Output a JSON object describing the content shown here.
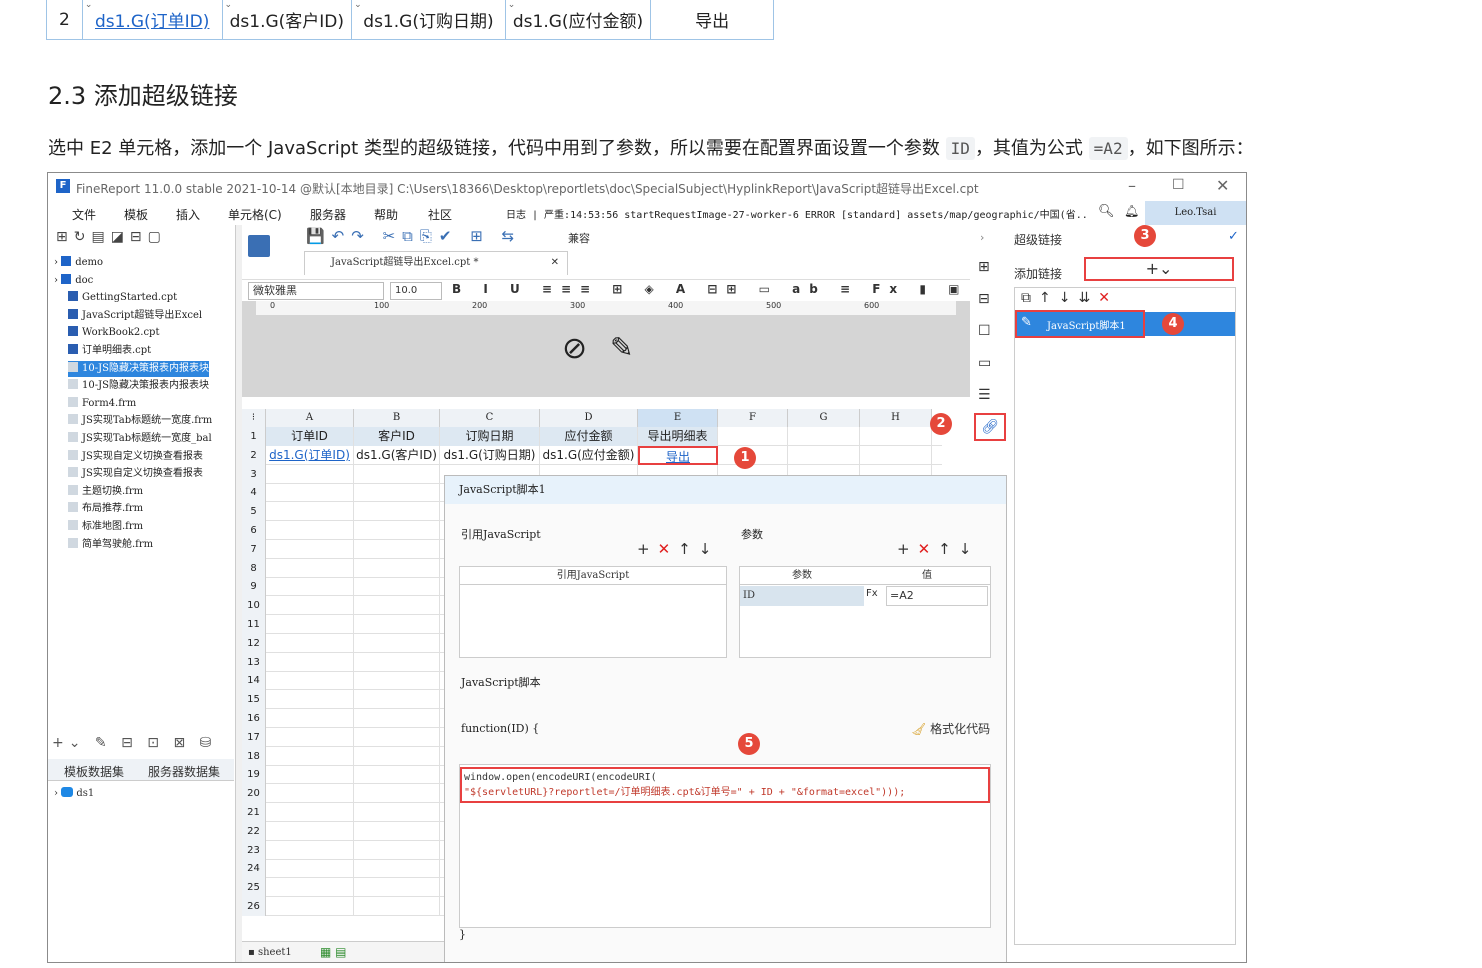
{
  "top_table": {
    "row": "2",
    "cells": [
      "ds1.G(订单ID)",
      "ds1.G(客户ID)",
      "ds1.G(订购日期)",
      "ds1.G(应付金额)",
      "导出"
    ]
  },
  "heading": "2.3 添加超级链接",
  "para": {
    "text1": "选中 E2 单元格，添加一个 JavaScript 类型的超级链接，代码中用到了参数，所以需要在配置界面设置一个参数",
    "code1": "ID",
    "text2": "，其值为公式",
    "code2": "=A2",
    "text3": "，如下图所示："
  },
  "window": {
    "title": "FineReport 11.0.0 stable 2021-10-14 @默认[本地目录]    C:\\Users\\18366\\Desktop\\reportlets\\doc\\SpecialSubject\\HyplinkReport\\JavaScript超链导出Excel.cpt",
    "menu": [
      "文件",
      "模板",
      "插入",
      "单元格(C)",
      "服务器",
      "帮助",
      "社区"
    ],
    "log": "日志 | 严重:14:53:56 startRequestImage-27-worker-6 ERROR [standard] assets/map/geographic/中国(省...",
    "user": "Leo.Tsai",
    "tab_label": "JavaScript超链导出Excel.cpt *",
    "font_name": "微软雅黑",
    "font_size": "10.0",
    "compat": "兼容",
    "sheet": "sheet1"
  },
  "tree": [
    "demo",
    "doc",
    "GettingStarted.cpt",
    "JavaScript超链导出Excel",
    "WorkBook2.cpt",
    "订单明细表.cpt",
    "10-JS隐藏决策报表内报表块",
    "10-JS隐藏决策报表内报表块",
    "Form4.frm",
    "JS实现Tab标题统一宽度.frm",
    "JS实现Tab标题统一宽度_bal",
    "JS实现自定义切换查看报表",
    "JS实现自定义切换查看报表",
    "主题切换.frm",
    "布局推荐.frm",
    "标准地图.frm",
    "简单驾驶舱.frm"
  ],
  "dataset_tabs": [
    "模板数据集",
    "服务器数据集"
  ],
  "dataset": "ds1",
  "ruler": [
    "0",
    "100",
    "200",
    "300",
    "400",
    "500",
    "600"
  ],
  "columns": [
    "A",
    "B",
    "C",
    "D",
    "E",
    "F",
    "G",
    "H"
  ],
  "header_row": [
    "订单ID",
    "客户ID",
    "订购日期",
    "应付金额",
    "导出明细表"
  ],
  "data_row": [
    "ds1.G(订单ID)",
    "ds1.G(客户ID)",
    "ds1.G(订购日期)",
    "ds1.G(应付金额)",
    "导出"
  ],
  "row_numbers": [
    "1",
    "2",
    "3",
    "4",
    "5",
    "6",
    "7",
    "8",
    "9",
    "10",
    "11",
    "12",
    "13",
    "14",
    "15",
    "16",
    "17",
    "18",
    "19",
    "20",
    "21",
    "22",
    "23",
    "24",
    "25",
    "26"
  ],
  "dialog": {
    "title": "JavaScript脚本1",
    "ref_js": "引用JavaScript",
    "params": "参数",
    "col_ref": "引用JavaScript",
    "col_param": "参数",
    "col_value": "值",
    "param_name": "ID",
    "param_value": "=A2",
    "script_label": "JavaScript脚本",
    "func_sig": "function(ID) {",
    "format_btn": "格式化代码",
    "code_line1": "window.open(encodeURI(encodeURI(",
    "code_line2": "\"${servletURL}?reportlet=/订单明细表.cpt&订单号=\" + ID + \"&format=excel\")));",
    "close_brace": "}"
  },
  "right_panel": {
    "title": "超级链接",
    "add_label": "添加链接",
    "item": "JavaScript脚本1"
  },
  "badges": [
    "1",
    "2",
    "3",
    "4",
    "5"
  ]
}
